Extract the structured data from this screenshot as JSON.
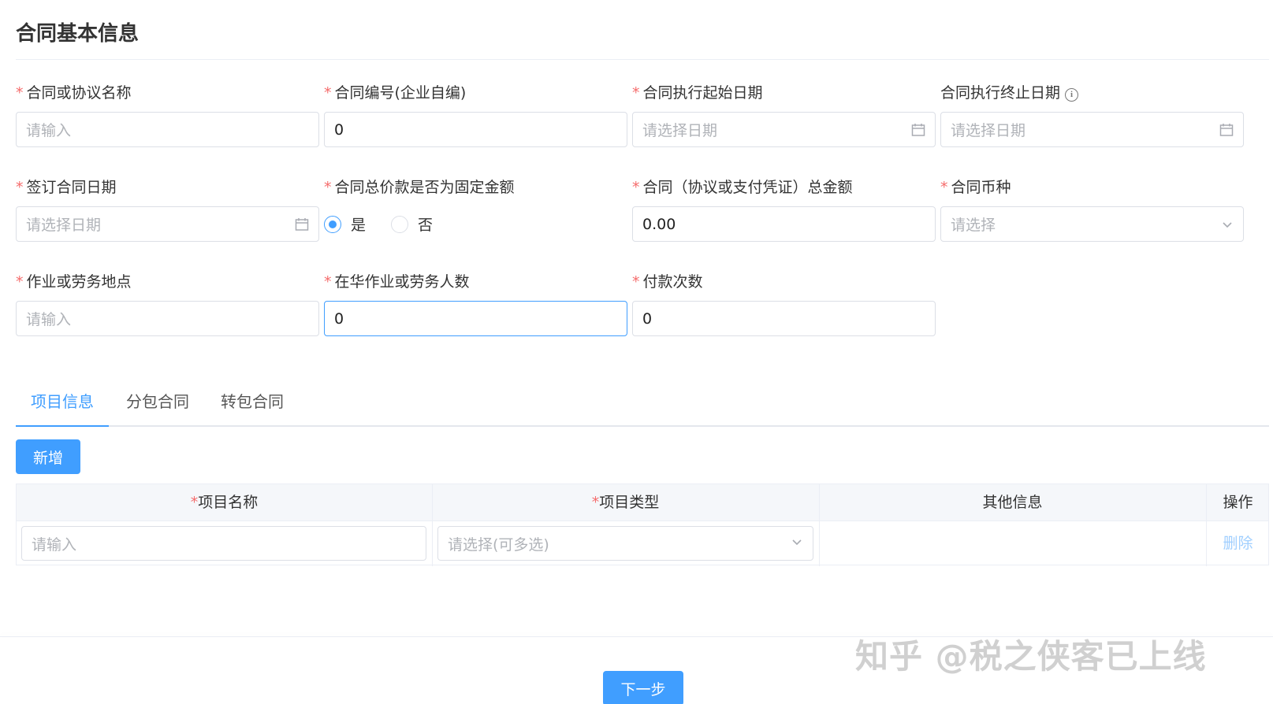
{
  "page": {
    "title": "合同基本信息"
  },
  "fields": {
    "contract_name": {
      "label": "合同或协议名称",
      "placeholder": "请输入"
    },
    "contract_no": {
      "label": "合同编号(企业自编)",
      "value": "0"
    },
    "start_date": {
      "label": "合同执行起始日期",
      "placeholder": "请选择日期"
    },
    "end_date": {
      "label": "合同执行终止日期",
      "placeholder": "请选择日期"
    },
    "sign_date": {
      "label": "签订合同日期",
      "placeholder": "请选择日期"
    },
    "fixed_price": {
      "label": "合同总价款是否为固定金额",
      "option_yes": "是",
      "option_no": "否",
      "selected": "是"
    },
    "total_amount": {
      "label": "合同（协议或支付凭证）总金额",
      "value": "0.00"
    },
    "currency": {
      "label": "合同币种",
      "placeholder": "请选择"
    },
    "work_location": {
      "label": "作业或劳务地点",
      "placeholder": "请输入"
    },
    "workers_count": {
      "label": "在华作业或劳务人数",
      "value": "0"
    },
    "payment_times": {
      "label": "付款次数",
      "value": "0"
    }
  },
  "tabs": [
    "项目信息",
    "分包合同",
    "转包合同"
  ],
  "actions": {
    "add": "新增",
    "next": "下一步"
  },
  "table": {
    "headers": [
      "项目名称",
      "项目类型",
      "其他信息",
      "操作"
    ],
    "row": {
      "name_placeholder": "请输入",
      "type_placeholder": "请选择(可多选)",
      "delete": "删除"
    }
  },
  "required_mark": "*",
  "watermark": "知乎 @税之侠客已上线",
  "colors": {
    "primary": "#409eff",
    "required": "#f56c6c",
    "border": "#dcdfe6",
    "link_disabled": "#a0cfff"
  },
  "icons": {
    "date": "calendar-icon",
    "select": "chevron-down-icon",
    "tooltip": "info-icon"
  }
}
